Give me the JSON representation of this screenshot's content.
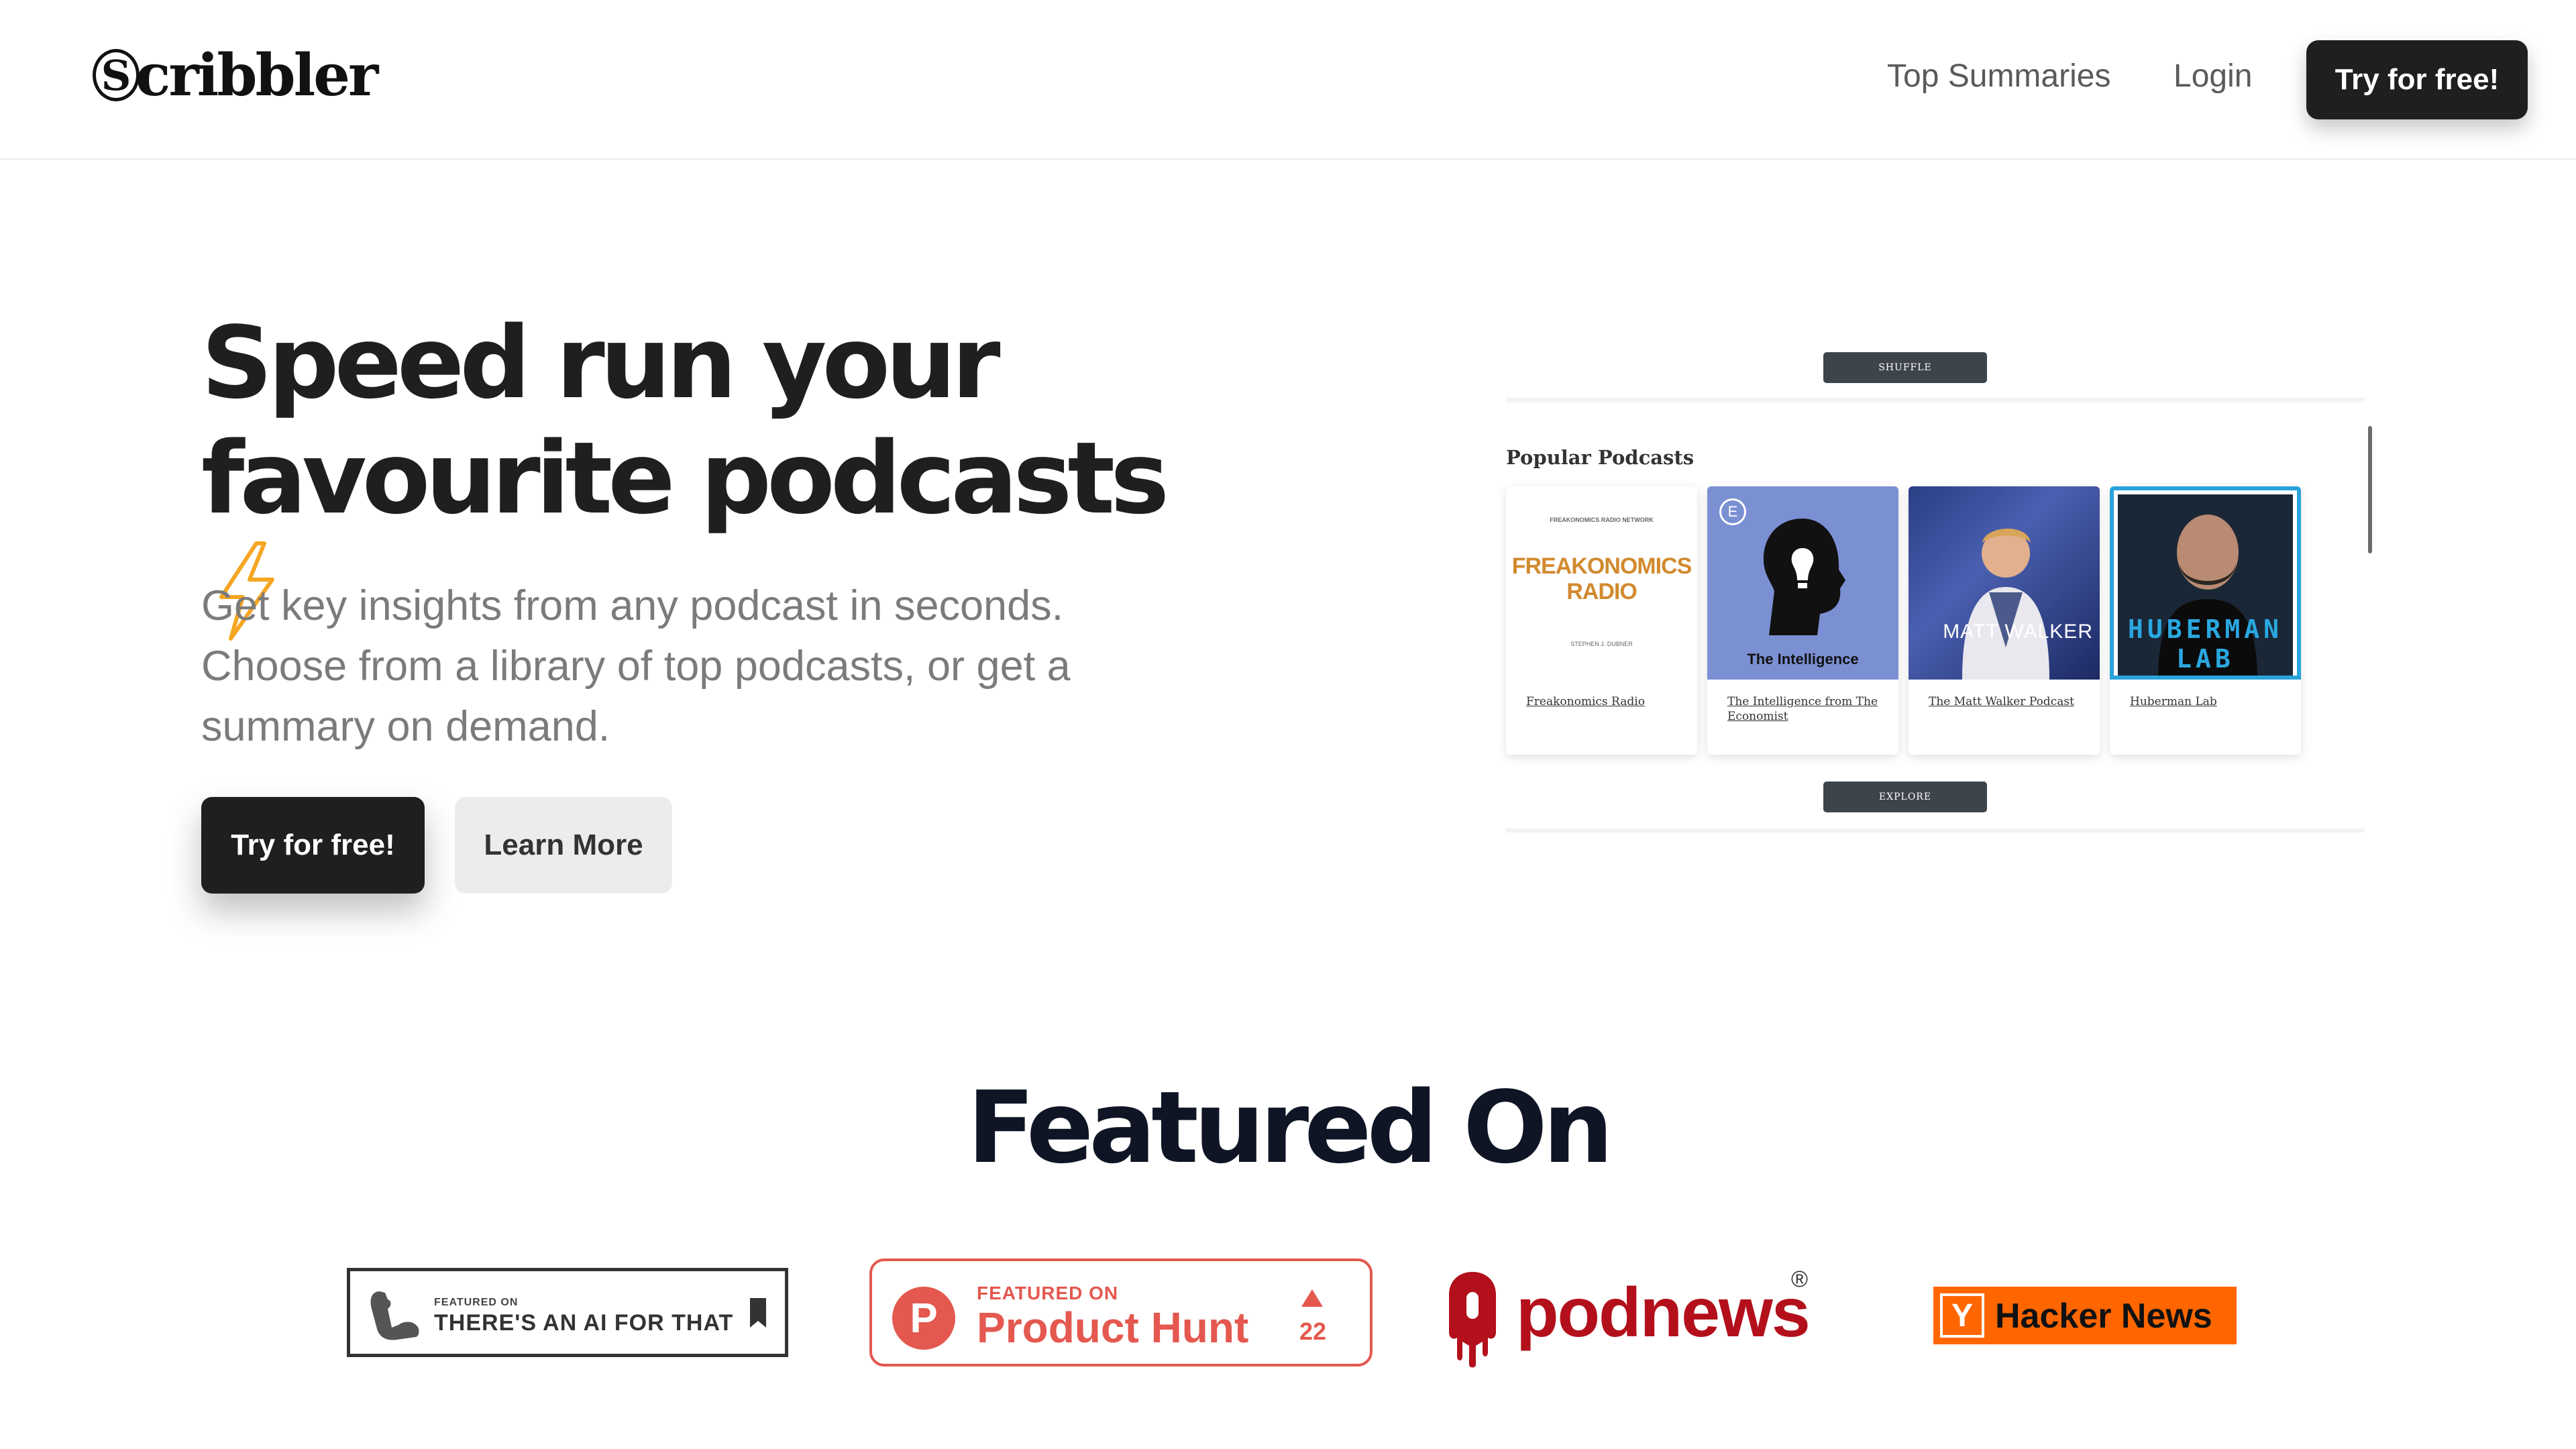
{
  "nav": {
    "logo_letter": "S",
    "logo_rest": "cribbler",
    "links": [
      "Top Summaries",
      "Login"
    ],
    "cta": "Try for free!"
  },
  "hero": {
    "title_line1": "Speed run your",
    "title_line2": "favourite podcasts",
    "bolt_icon": "lightning-bolt-icon",
    "subtitle": "Get key insights from any podcast in seconds. Choose from a library of top podcasts, or get a summary on demand.",
    "primary_button": "Try for free!",
    "secondary_button": "Learn More"
  },
  "preview": {
    "shuffle_label": "SHUFFLE",
    "heading": "Popular Podcasts",
    "explore_label": "EXPLORE",
    "cards": [
      {
        "art_top": "FREAKONOMICS RADIO NETWORK",
        "art_title": "FREAKONOMICS RADIO",
        "art_bottom": "STEPHEN J. DUBNER",
        "caption": "Freakonomics Radio"
      },
      {
        "art_title": "The Intelligence",
        "art_badge": "E",
        "caption": "The Intelligence from The Economist"
      },
      {
        "art_title": "MATT WALKER",
        "caption": "The Matt Walker Podcast"
      },
      {
        "art_title": "HUBERMAN LAB",
        "caption": "Huberman Lab"
      }
    ]
  },
  "featured": {
    "title": "Featured On",
    "badges": {
      "aift": {
        "small": "FEATURED ON",
        "big": "THERE'S AN AI FOR THAT"
      },
      "producthunt": {
        "small": "FEATURED ON",
        "big": "Product Hunt",
        "letter": "P",
        "count": "22"
      },
      "podnews": {
        "text": "podnews",
        "reg": "®"
      },
      "hackernews": {
        "letter": "Y",
        "text": "Hacker News"
      }
    }
  },
  "colors": {
    "dark": "#1f1f1f",
    "producthunt": "#e4584f",
    "podnews": "#b3101b",
    "hackernews": "#ff6600",
    "bolt": "#f5a623"
  }
}
